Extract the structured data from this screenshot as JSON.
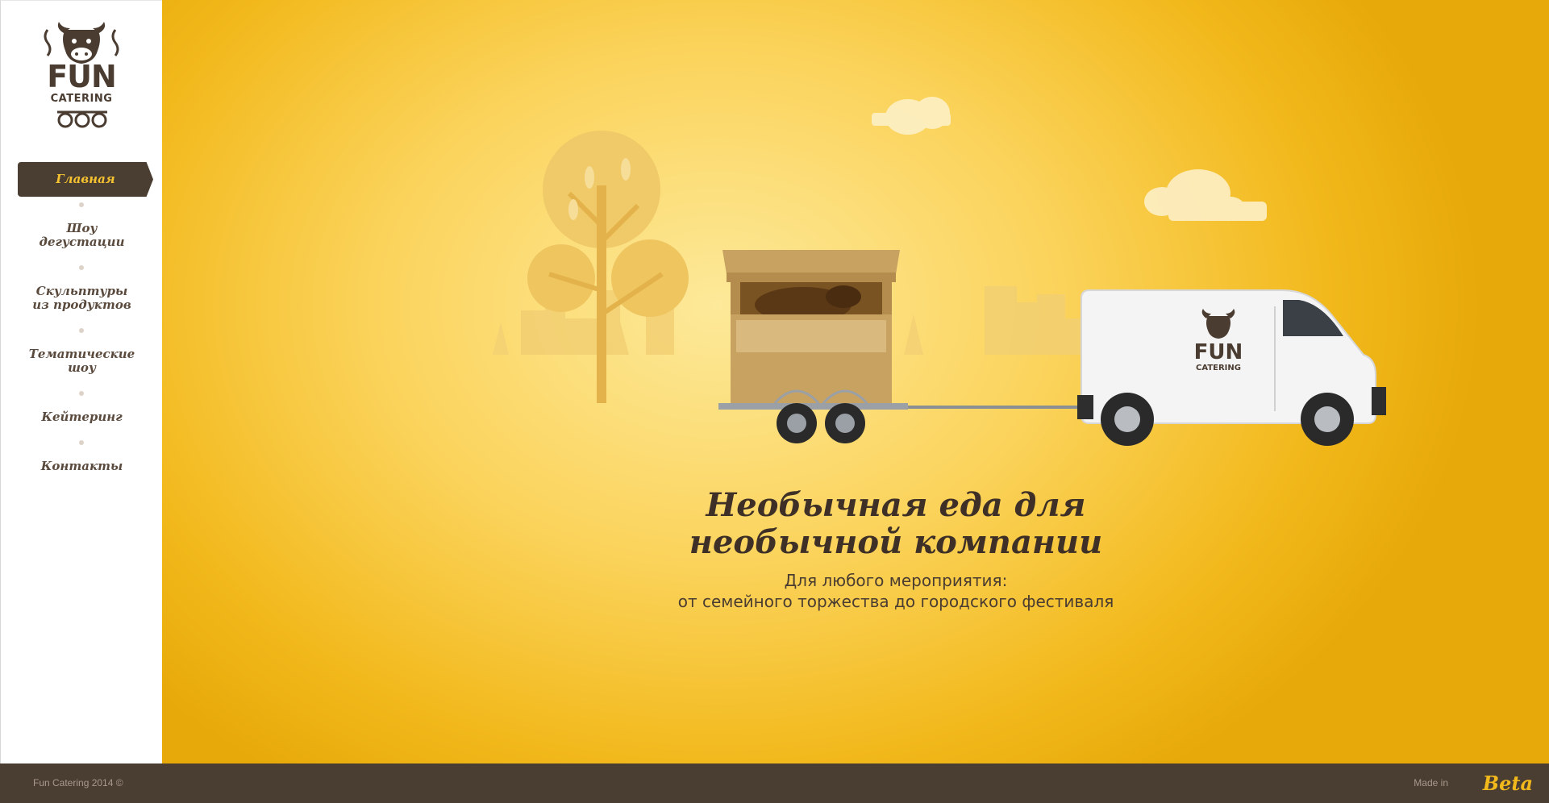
{
  "brand": {
    "logo_top": "FUN",
    "logo_bottom": "CATERING"
  },
  "nav": {
    "items": [
      {
        "label": "Главная",
        "active": true
      },
      {
        "label": "Шоу\nдегустации",
        "active": false
      },
      {
        "label": "Скульптуры\nиз продуктов",
        "active": false
      },
      {
        "label": "Тематические\nшоу",
        "active": false
      },
      {
        "label": "Кейтеринг",
        "active": false
      },
      {
        "label": "Контакты",
        "active": false
      }
    ]
  },
  "hero": {
    "van_logo_top": "FUN",
    "van_logo_bottom": "CATERING",
    "headline": "Необычная еда для необычной компании",
    "subline_1": "Для любого мероприятия:",
    "subline_2": "от семейного торжества до городского фестиваля"
  },
  "footer": {
    "copyright": "Fun Catering 2014 ©",
    "made_in": "Made in",
    "agency": "Beta"
  },
  "colors": {
    "accent": "#f2b91c",
    "dark_brown": "#4a3d31",
    "light_yellow": "#fde99a"
  }
}
